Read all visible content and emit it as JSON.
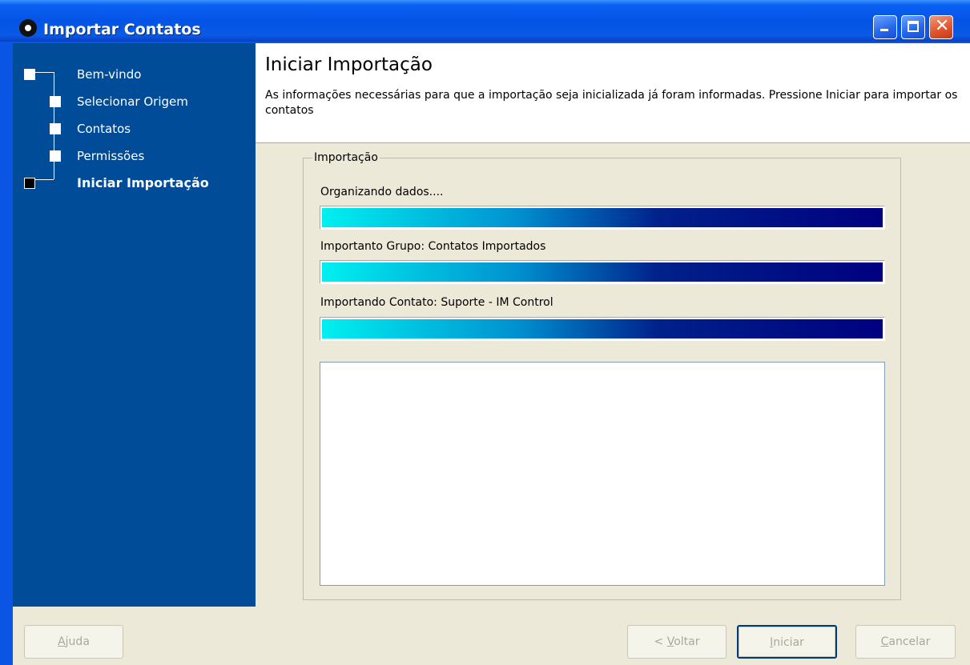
{
  "window": {
    "title": "Importar Contatos",
    "icon": "app-icon",
    "controls": {
      "minimize": "minimize-icon",
      "maximize": "maximize-icon",
      "close": "close-icon",
      "close_glyph": "✕"
    }
  },
  "sidebar": {
    "steps": [
      {
        "label": "Bem-vindo",
        "state": "done"
      },
      {
        "label": "Selecionar Origem",
        "state": "done"
      },
      {
        "label": "Contatos",
        "state": "done"
      },
      {
        "label": "Permissões",
        "state": "done"
      },
      {
        "label": "Iniciar Importação",
        "state": "current"
      }
    ]
  },
  "header": {
    "title": "Iniciar Importação",
    "description": "As informações necessárias para que a importação seja inicializada já foram informadas. Pressione Iniciar para importar os contatos"
  },
  "import_group": {
    "label": "Importação",
    "progress": [
      {
        "label": "Organizando dados....",
        "percent": 100
      },
      {
        "label": "Importanto Grupo: Contatos Importados",
        "percent": 100
      },
      {
        "label": "Importando Contato: Suporte - IM Control",
        "percent": 100
      }
    ],
    "log_text": ""
  },
  "buttons": {
    "help": {
      "pre": "",
      "accel": "A",
      "post": "juda",
      "enabled": false
    },
    "back": {
      "pre": "< ",
      "accel": "V",
      "post": "oltar",
      "enabled": false
    },
    "start": {
      "pre": "",
      "accel": "I",
      "post": "niciar",
      "enabled": false
    },
    "cancel": {
      "pre": "",
      "accel": "C",
      "post": "ancelar",
      "enabled": false
    }
  },
  "colors": {
    "sidebar_bg": "#004c98",
    "titlebar": "#0454e6",
    "progress_start": "#00f0f0",
    "progress_end": "#000080",
    "disabled_text": "#aca899"
  }
}
